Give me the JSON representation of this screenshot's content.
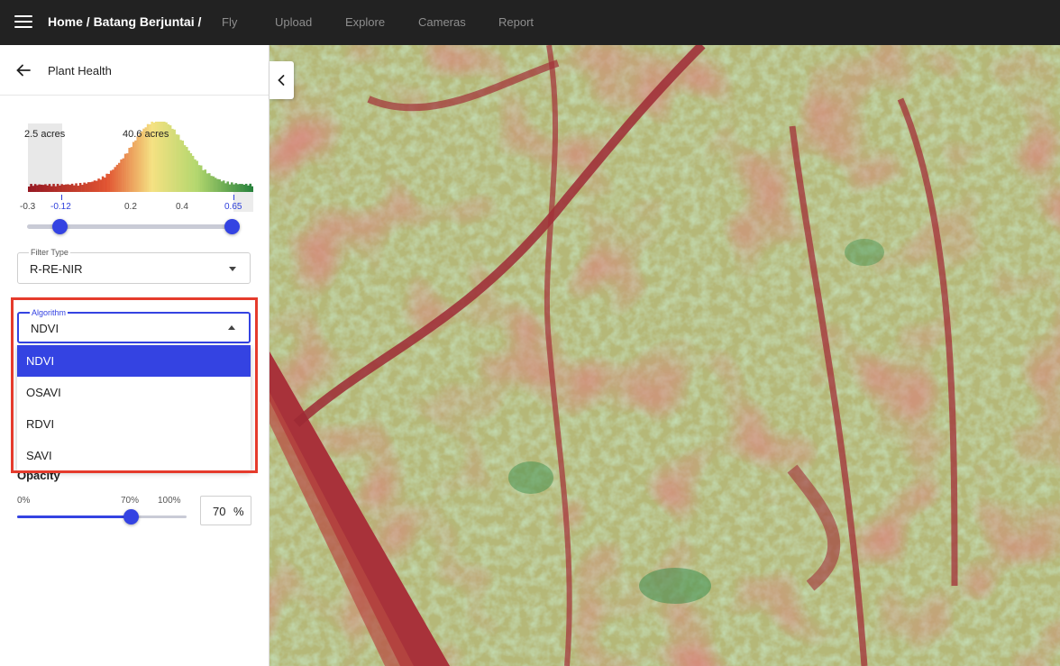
{
  "header": {
    "breadcrumb": "Home / Batang Berjuntai /",
    "nav": [
      "Fly",
      "Upload",
      "Explore",
      "Cameras",
      "Report"
    ]
  },
  "panel": {
    "title": "Plant Health"
  },
  "histogram": {
    "left_acres": "2.5 acres",
    "right_acres": "40.6 acres",
    "ticks": [
      "-0.3",
      "-0.12",
      "0.2",
      "0.4",
      "0.65"
    ],
    "range_min": -0.12,
    "range_max": 0.65
  },
  "filter": {
    "label": "Filter Type",
    "value": "R-RE-NIR"
  },
  "algorithm": {
    "label": "Algorithm",
    "value": "NDVI",
    "options": [
      "NDVI",
      "OSAVI",
      "RDVI",
      "SAVI"
    ]
  },
  "opacity": {
    "label": "Opacity",
    "min_label": "0%",
    "current_label": "70%",
    "max_label": "100%",
    "value": "70",
    "unit": "%",
    "level": 0.7
  },
  "colors": {
    "accent": "#3443e2",
    "highlight": "#e53b2c",
    "topbar": "#222222"
  },
  "icons": [
    "menu-icon",
    "arrow-left-icon",
    "caret-down-icon",
    "caret-up-icon",
    "chevron-left-icon"
  ]
}
